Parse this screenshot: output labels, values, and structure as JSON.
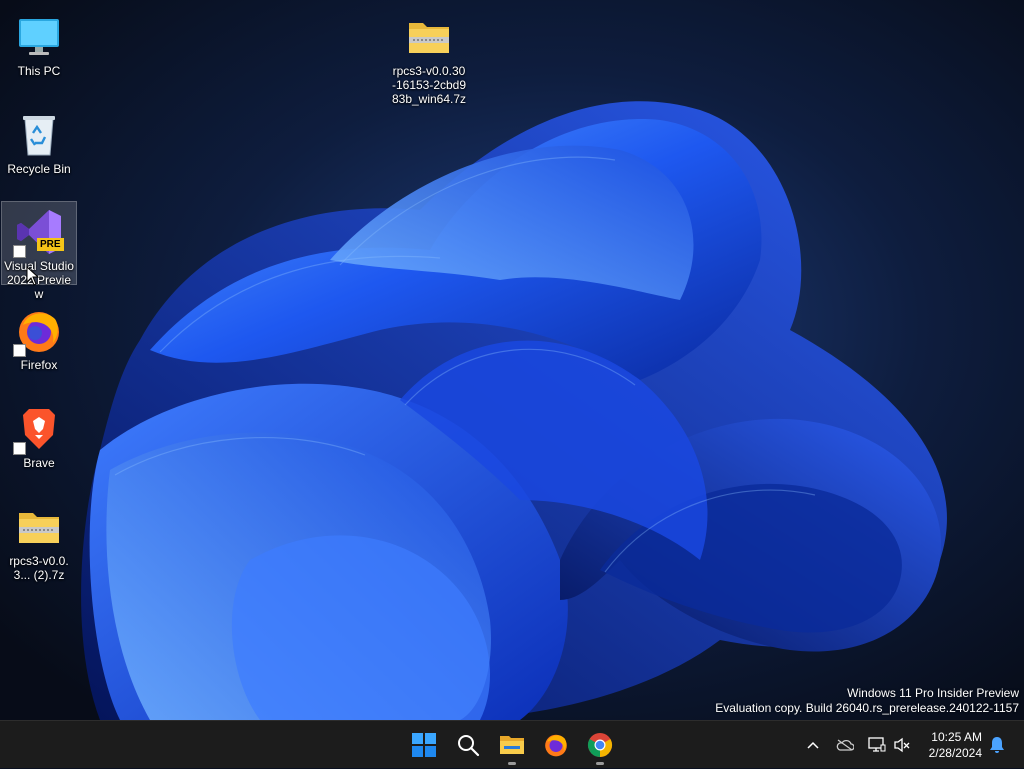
{
  "desktop": {
    "icons": [
      {
        "label": "This PC",
        "icon": "monitor-icon"
      },
      {
        "label": "Recycle Bin",
        "icon": "recycle-bin-icon"
      },
      {
        "label": "Visual Studio 2022 Preview",
        "icon": "visual-studio-icon",
        "badge": "PRE",
        "selected": true
      },
      {
        "label": "Firefox",
        "icon": "firefox-icon"
      },
      {
        "label": "Brave",
        "icon": "brave-icon"
      },
      {
        "label": "rpcs3-v0.0.3... (2).7z",
        "icon": "zip-folder-icon"
      },
      {
        "label": "rpcs3-v0.0.30-16153-2cbd983b_win64.7z",
        "icon": "zip-folder-icon"
      }
    ]
  },
  "watermark": {
    "line1": "Windows 11 Pro Insider Preview",
    "line2": "Evaluation copy. Build 26040.rs_prerelease.240122-1157"
  },
  "taskbar": {
    "pinned": [
      {
        "name": "start",
        "icon": "windows-logo-icon"
      },
      {
        "name": "search",
        "icon": "search-icon"
      },
      {
        "name": "file-explorer",
        "icon": "folder-icon",
        "running": true
      },
      {
        "name": "firefox",
        "icon": "firefox-icon"
      },
      {
        "name": "chrome",
        "icon": "chrome-icon",
        "running": true
      }
    ],
    "tray": {
      "icons": [
        "chevron-up-icon",
        "onedrive-icon",
        "network-icon",
        "volume-muted-icon",
        "notification-bell-icon"
      ]
    },
    "clock": {
      "time": "10:25 AM",
      "date": "2/28/2024"
    }
  },
  "colors": {
    "accent": "#0a64ff",
    "taskbar": "#1c1c1c",
    "wallpaper_dark": "#0a1020"
  }
}
